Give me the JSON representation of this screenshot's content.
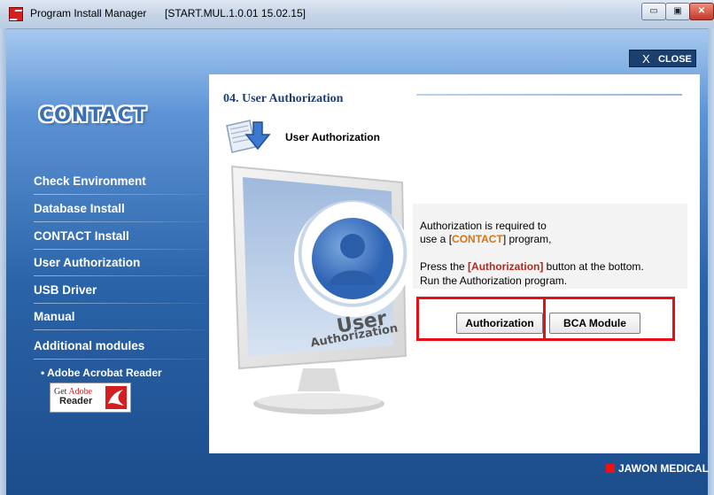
{
  "window": {
    "title": "Program Install Manager",
    "build": "[START.MUL.1.0.01 15.02.15]",
    "minimize_symbol": "▭",
    "maximize_symbol": "▣",
    "close_symbol": "✕"
  },
  "header": {
    "close_label": "CLOSE",
    "close_symbol": "X"
  },
  "sidebar": {
    "logo": "CONTACT",
    "items": [
      {
        "label": "Check Environment"
      },
      {
        "label": "Database Install"
      },
      {
        "label": "CONTACT Install"
      },
      {
        "label": "User Authorization"
      },
      {
        "label": "USB Driver"
      },
      {
        "label": "Manual"
      },
      {
        "label": "Additional modules"
      }
    ],
    "sub_item": "• Adobe Acrobat Reader",
    "adobe_badge": {
      "get": "Get ",
      "brand": "Adobe",
      "product": "Reader"
    }
  },
  "main": {
    "step_title": "04. User Authorization",
    "section_title": "User Authorization",
    "illustration": {
      "line1": "User",
      "line2": "Authorization"
    },
    "info": {
      "line1": "Authorization is required to",
      "line2_prefix": "use a  [",
      "line2_program": "CONTACT",
      "line2_suffix": "] program,",
      "line3_prefix": "Press the ",
      "line3_button": "[Authorization]",
      "line3_suffix": " button at the bottom.",
      "line4": "Run the Authorization program."
    },
    "buttons": {
      "authorization": "Authorization",
      "bca_module": "BCA Module"
    }
  },
  "footer": {
    "brand": "JAWON MEDICAL"
  },
  "colors": {
    "accent_red": "#e60f13",
    "highlight_orange": "#d2751c",
    "navy": "#1f3e73"
  }
}
